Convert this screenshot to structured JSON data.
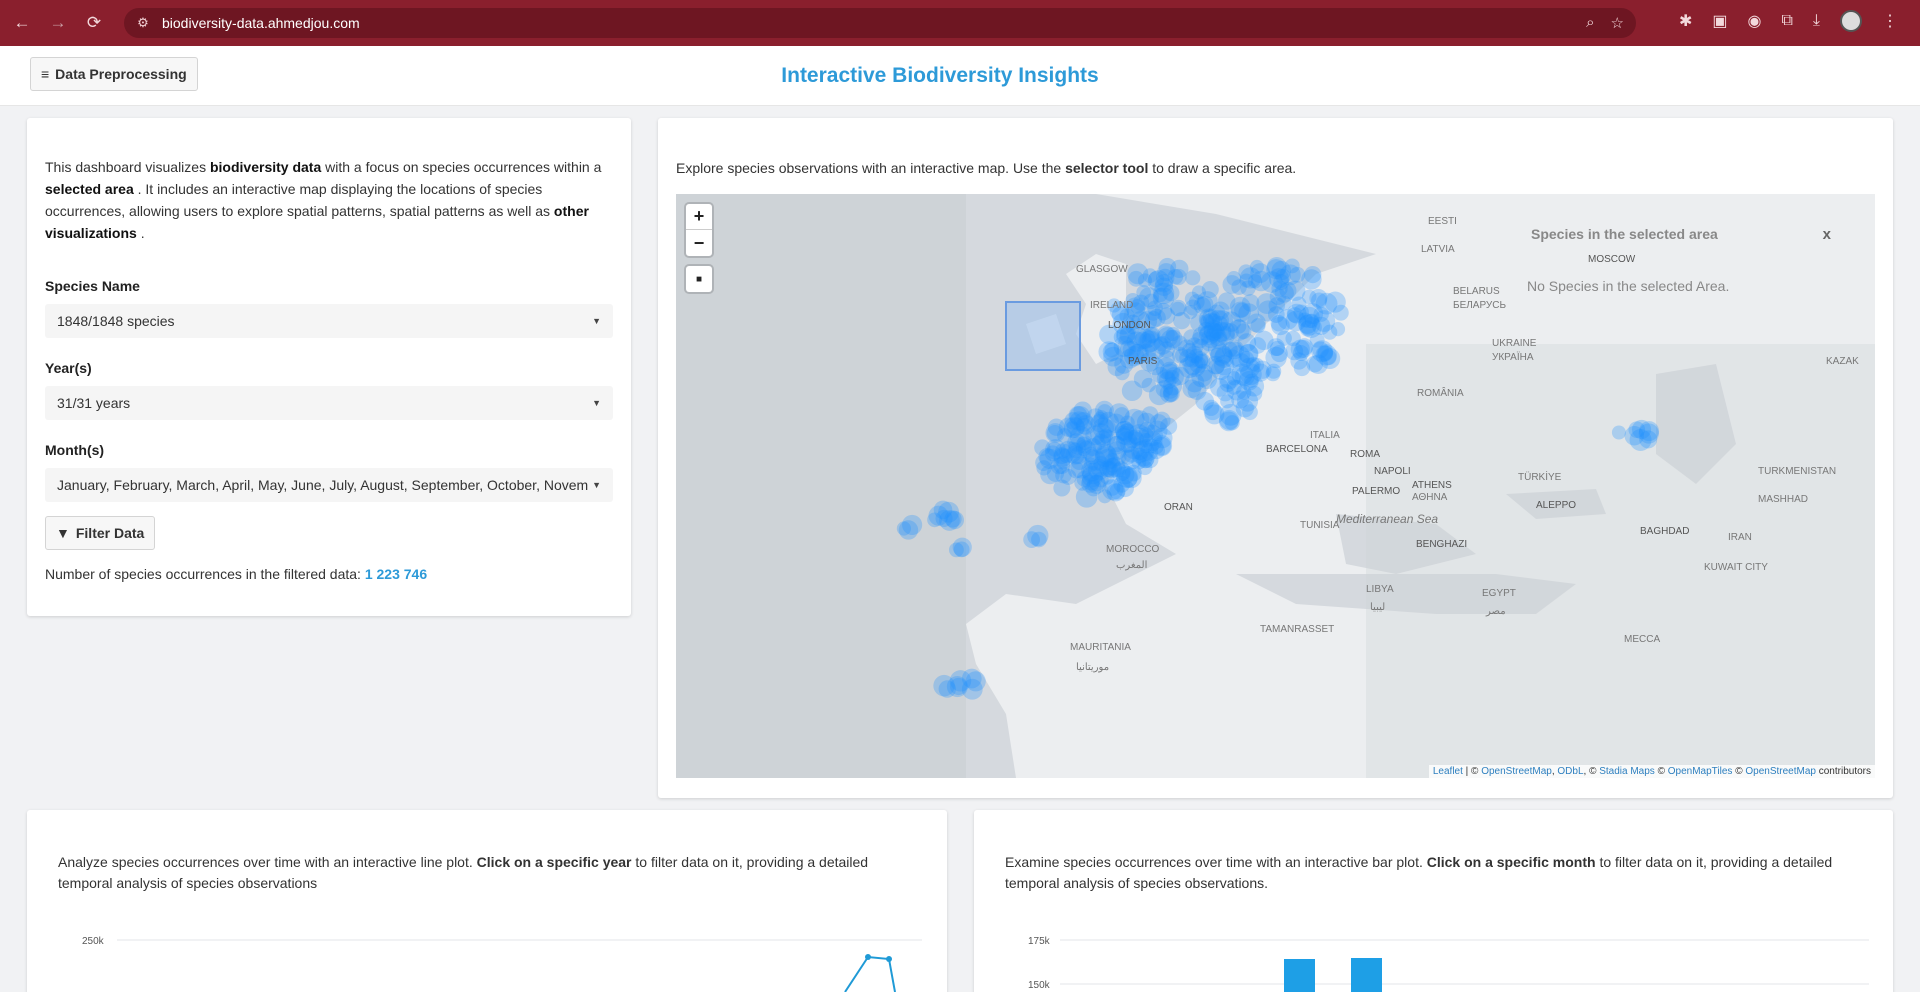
{
  "browser": {
    "url": "biodiversity-data.ahmedjou.com",
    "icons": [
      "back-icon",
      "forward-icon",
      "reload-icon",
      "site-info-icon",
      "zoom-icon",
      "star-icon",
      "extension-icon",
      "profile-icon",
      "menu-icon"
    ]
  },
  "header": {
    "preprocess_button": "Data Preprocessing",
    "title": "Interactive Biodiversity Insights"
  },
  "sidebar": {
    "intro": {
      "p1": "This dashboard visualizes ",
      "b1": "biodiversity data",
      "p2": " with a focus on species occurrences within a ",
      "b2": "selected area",
      "p3": " . It includes an interactive map displaying the locations of species occurrences, allowing users to explore spatial patterns, spatial patterns as well as ",
      "b3": "other visualizations",
      "p4": " ."
    },
    "species_label": "Species Name",
    "species_value": "1848/1848 species",
    "years_label": "Year(s)",
    "years_value": "31/31 years",
    "months_label": "Month(s)",
    "months_value": "January, February, March, April, May, June, July, August, September, October, Novem",
    "filter_button": "Filter Data",
    "count_label": "Number of species occurrences in the filtered data: ",
    "count_value": "1 223 746"
  },
  "map": {
    "desc_p1": "Explore species observations with an interactive map. Use the ",
    "desc_b": "selector tool",
    "desc_p2": " to draw a specific area.",
    "zoom_in": "+",
    "zoom_out": "−",
    "info_title": "Species in the selected area",
    "info_close": "x",
    "info_empty": "No Species in the selected Area.",
    "attribution": {
      "leaflet": "Leaflet",
      "a1": " | © ",
      "osm": "OpenStreetMap",
      "a2": ", ",
      "odbl": "ODbL",
      "a3": ", © ",
      "stadia": "Stadia Maps",
      "a4": " © ",
      "omt": "OpenMapTiles",
      "a5": " © ",
      "osm2": "OpenStreetMap",
      "a6": " contributors"
    },
    "labels": {
      "latvia": "LATVIA",
      "belarus": "BELARUS",
      "belarus_cyr": "БЕЛАРУСЬ",
      "eesti": "EESTI",
      "moscow": "MOSCOW",
      "ukraine": "UKRAINE",
      "ukraine_cyr": "УКРАЇНА",
      "ireland": "IRELAND",
      "london": "LONDON",
      "paris": "PARIS",
      "glasgow": "GLASGOW",
      "romania": "ROMÂNIA",
      "italia": "ITALIA",
      "roma": "ROMA",
      "napoli": "NAPOLI",
      "barcelona": "BARCELONA",
      "athens": "ATHENS",
      "athens_gr": "ΑΘΗΝΑ",
      "turkiye": "TÜRKİYE",
      "palermo": "PALERMO",
      "tunisia": "TUNISIA",
      "med_sea": "Mediterranean Sea",
      "morocco": "MOROCCO",
      "morocco_ar": "المغرب",
      "libya": "LIBYA",
      "libya_ar": "ليبيا",
      "egypt": "EGYPT",
      "egypt_ar": "مصر",
      "mauritania": "MAURITANIA",
      "mauritania_ar": "موريتانيا",
      "tamanrasset": "TAMANRASSET",
      "turkmenistan": "TURKMENISTAN",
      "iran": "IRAN",
      "baghdad": "BAGHDAD",
      "kuwait": "KUWAIT CITY",
      "kazak": "KAZAK",
      "mecca": "MECCA",
      "aleppo": "ALEPPO",
      "oran": "ORAN",
      "benghazi": "BENGHAZI",
      "mashhad": "MASHHAD"
    },
    "accent": "#2196f3"
  },
  "line_panel": {
    "p1": "Analyze species occurrences over time with an interactive line plot. ",
    "b": "Click on a specific year",
    "p2": " to filter data on it, providing a detailed temporal analysis of species observations",
    "ytick": "250k"
  },
  "bar_panel": {
    "p1": "Examine species occurrences over time with an interactive bar plot. ",
    "b": "Click on a specific month",
    "p2": " to filter data on it, providing a detailed temporal analysis of species observations.",
    "ytick1": "175k",
    "ytick2": "150k"
  },
  "colors": {
    "browser_bar": "#8a1f2d",
    "title": "#2d9ad8",
    "points": "#1e90ff"
  }
}
